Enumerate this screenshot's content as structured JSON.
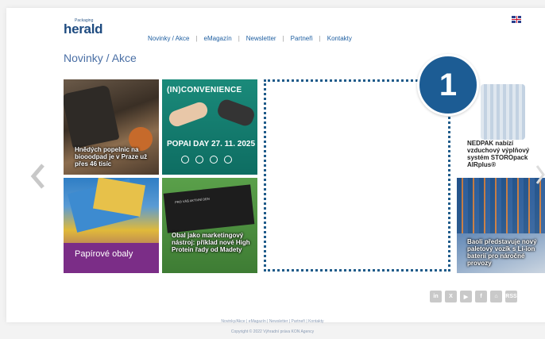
{
  "header": {
    "logo_small": "Packaging",
    "logo_main": "herald",
    "nav": [
      "Novinky / Akce",
      "eMagazín",
      "Newsletter",
      "Partneři",
      "Kontakty"
    ],
    "language_icon": "uk-flag-icon"
  },
  "page_title": "Novinky / Akce",
  "tiles": {
    "t1": "Hnědých popelnic na biooodpad je v Praze už přes 46 tisíc",
    "t2_headline": "(IN)CONVENIENCE",
    "t2_event": "POPAI DAY 27. 11. 2025",
    "t3": "Papírové obaly",
    "t4": "Obal jako marketingový nástroj: příklad nové High Protein řady od Madety",
    "t4_box": "PRO VÁŠ AKTIVNÍ DEN",
    "t5": "NEDPAK nabízí vzduchový výplňový systém STOROpack AIRplus®",
    "t6": "Baoli představuje nový paletový vozík s Li-ion baterií pro náročné provozy"
  },
  "callout": {
    "number": "1"
  },
  "social_icons": [
    "in",
    "X",
    "▶",
    "f",
    "⌂",
    "RSS"
  ],
  "footer": {
    "links": "Novinky/Akce | eMagazín | Newsletter | Partneři | Kontakty",
    "copyright": "Copyright © 2022 Výhradní práva KON Agency"
  }
}
